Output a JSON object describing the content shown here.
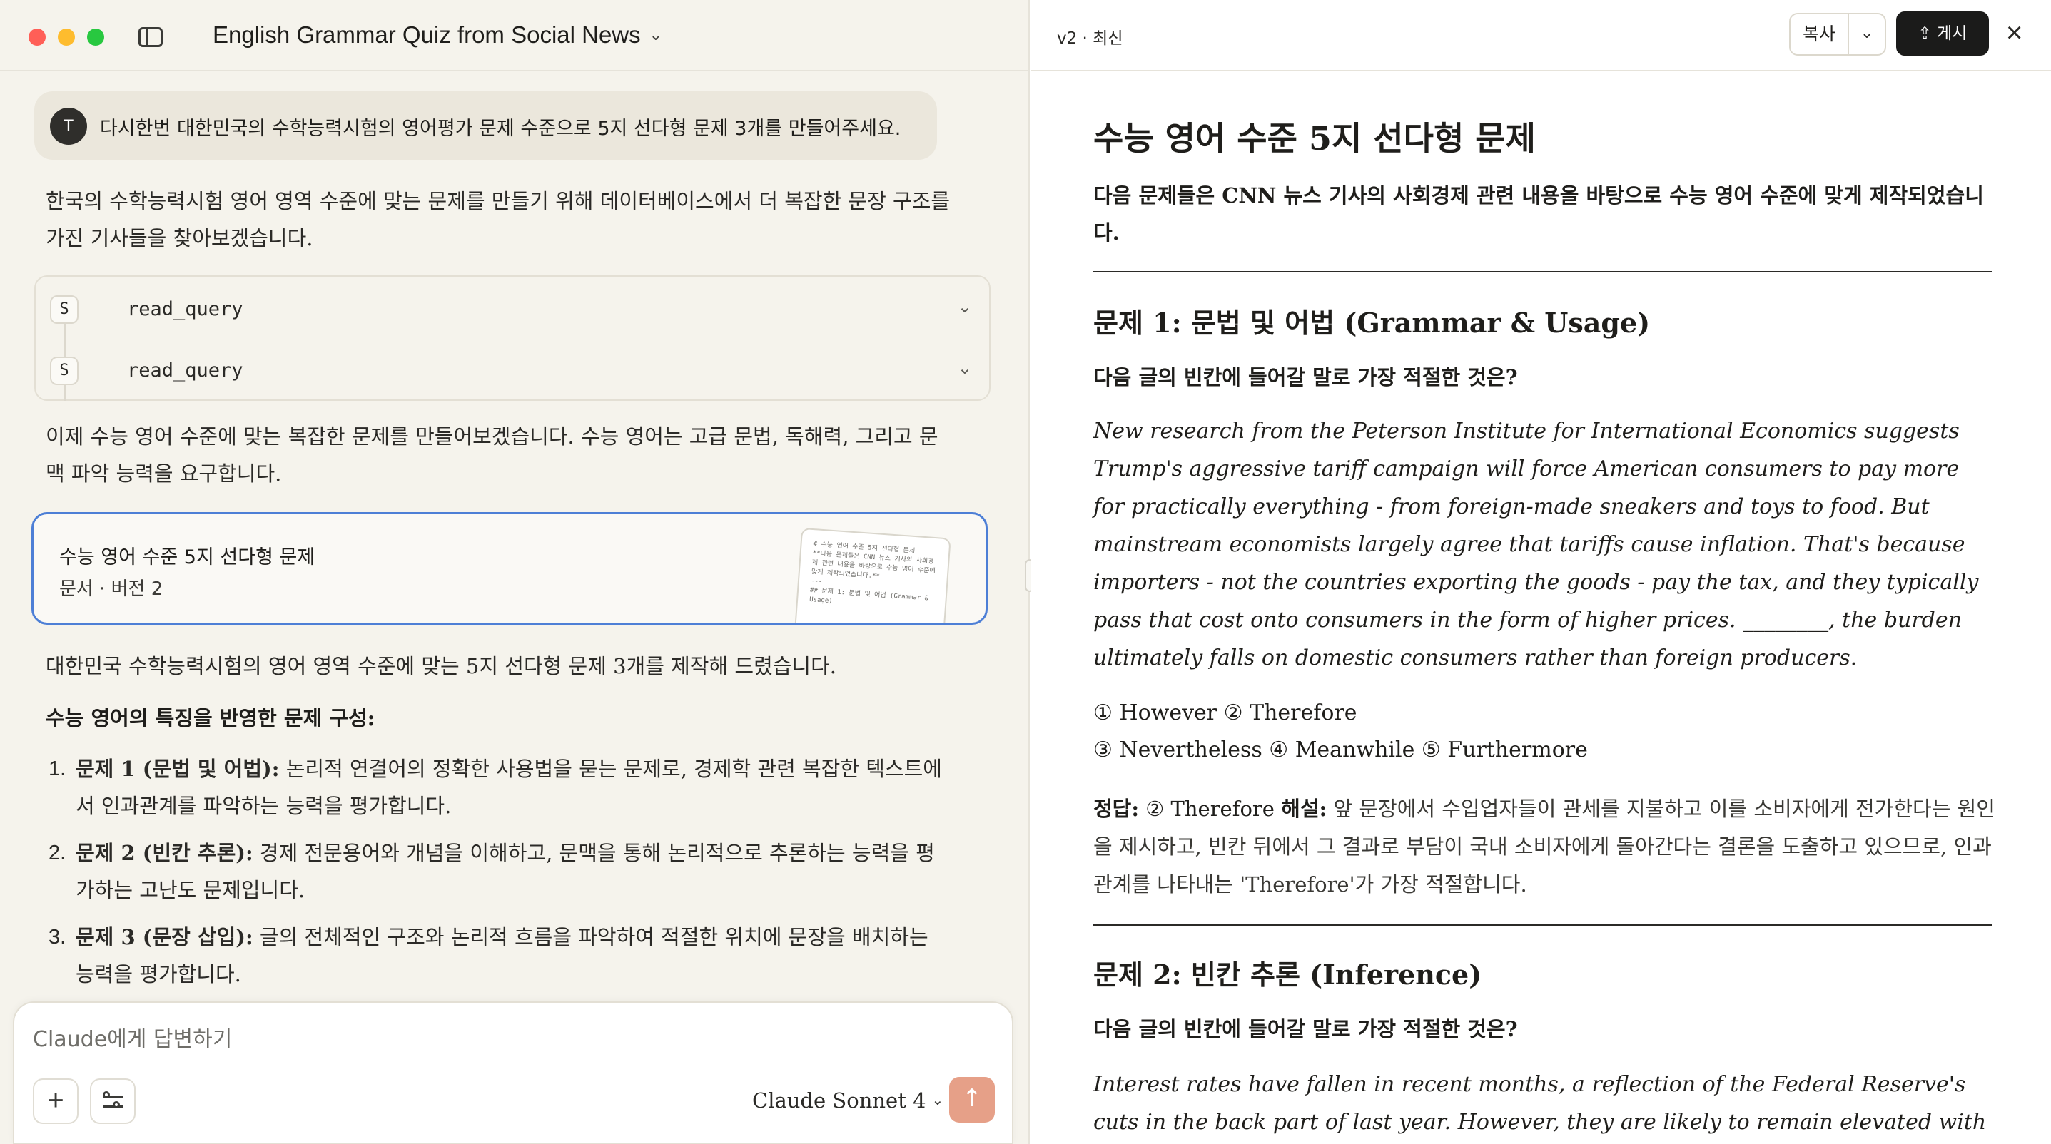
{
  "chat": {
    "title": "English Grammar Quiz from Social News",
    "user_avatar": "T",
    "user_message": "다시한번 대한민국의 수학능력시험의 영어평가 문제 수준으로 5지 선다형 문제 3개를 만들어주세요.",
    "assistant_para1": "한국의 수학능력시험 영어 영역 수준에 맞는 문제를 만들기 위해 데이터베이스에서 더 복잡한 문장 구조를 가진 기사들을 찾아보겠습니다.",
    "tools": [
      {
        "badge": "S",
        "label": "read_query"
      },
      {
        "badge": "S",
        "label": "read_query"
      }
    ],
    "assistant_para2": "이제 수능 영어 수준에 맞는 복잡한 문제를 만들어보겠습니다. 수능 영어는 고급 문법, 독해력, 그리고 문맥 파악 능력을 요구합니다.",
    "doc_card": {
      "title": "수능 영어 수준 5지 선다형 문제",
      "meta": "문서 · 버전 2",
      "thumb_text": "# 수능 영어 수준 5지 선다형 문제\n**다음 문제들은 CNN 뉴스 기사의 사회경제 관련 내용을 바탕으로 수능 영어 수준에 맞게 제작되었습니다.**\n---\n## 문제 1: 문법 및 어법 (Grammar & Usage)"
    },
    "assistant_para3": "대한민국 수학능력시험의 영어 영역 수준에 맞는 5지 선다형 문제 3개를 제작해 드렸습니다.",
    "list_heading": "수능 영어의 특징을 반영한 문제 구성:",
    "list_items": [
      {
        "num": "1.",
        "bold": "문제 1 (문법 및 어법):",
        "text": " 논리적 연결어의 정확한 사용법을 묻는 문제로, 경제학 관련 복잡한 텍스트에서 인과관계를 파악하는 능력을 평가합니다."
      },
      {
        "num": "2.",
        "bold": "문제 2 (빈칸 추론):",
        "text": " 경제 전문용어와 개념을 이해하고, 문맥을 통해 논리적으로 추론하는 능력을 평가하는 고난도 문제입니다."
      },
      {
        "num": "3.",
        "bold": "문제 3 (문장 삽입):",
        "text": " 글의 전체적인 구조와 논리적 흐름을 파악하여 적절한 위치에 문장을 배치하는 능력을 평가합니다."
      }
    ],
    "composer": {
      "placeholder": "Claude에게 답변하기",
      "plus_icon": "+",
      "model": "Claude Sonnet 4",
      "send_icon": "↑"
    }
  },
  "artifact": {
    "version": "v2 · 최신",
    "copy_label": "복사",
    "publish_label": "게시",
    "title": "수능 영어 수준 5지 선다형 문제",
    "intro": "다음 문제들은 CNN 뉴스 기사의 사회경제 관련 내용을 바탕으로 수능 영어 수준에 맞게 제작되었습니다.",
    "q1_heading": "문제 1: 문법 및 어법 (Grammar & Usage)",
    "q1_prompt": "다음 글의 빈칸에 들어갈 말로 가장 적절한 것은?",
    "q1_passage": "New research from the Peterson Institute for International Economics suggests Trump's aggressive tariff campaign will force American consumers to pay more for practically everything - from foreign-made sneakers and toys to food. But mainstream economists largely agree that tariffs cause inflation. That's because importers - not the countries exporting the goods - pay the tax, and they typically pass that cost onto consumers in the form of higher prices. ________, the burden ultimately falls on domestic consumers rather than foreign producers.",
    "q1_options_line1": "① However ② Therefore",
    "q1_options_line2": "③ Nevertheless ④ Meanwhile ⑤ Furthermore",
    "q1_answer_label": "정답:",
    "q1_answer_value": " ② Therefore ",
    "q1_explain_label": "해설:",
    "q1_explain": " 앞 문장에서 수입업자들이 관세를 지불하고 이를 소비자에게 전가한다는 원인을 제시하고, 빈칸 뒤에서 그 결과로 부담이 국내 소비자에게 돌아간다는 결론을 도출하고 있으므로, 인과관계를 나타내는 'Therefore'가 가장 적절합니다.",
    "q2_heading": "문제 2: 빈칸 추론 (Inference)",
    "q2_prompt": "다음 글의 빈칸에 들어갈 말로 가장 적절한 것은?",
    "q2_passage": "Interest rates have fallen in recent months, a reflection of the Federal Reserve's cuts in the back part of last year. However, they are likely to remain elevated with inflation"
  },
  "icons": {
    "sidebar_toggle": "sidebar-toggle-icon",
    "close": "close-icon",
    "upload": "upload-icon",
    "chevron": "chevron-down-icon",
    "settings": "sliders-icon"
  },
  "colors": {
    "left_bg": "#f5f3ec",
    "card_border": "#4d7fd6",
    "send_button": "#e6a088",
    "publish_button": "#1b1b1a"
  }
}
